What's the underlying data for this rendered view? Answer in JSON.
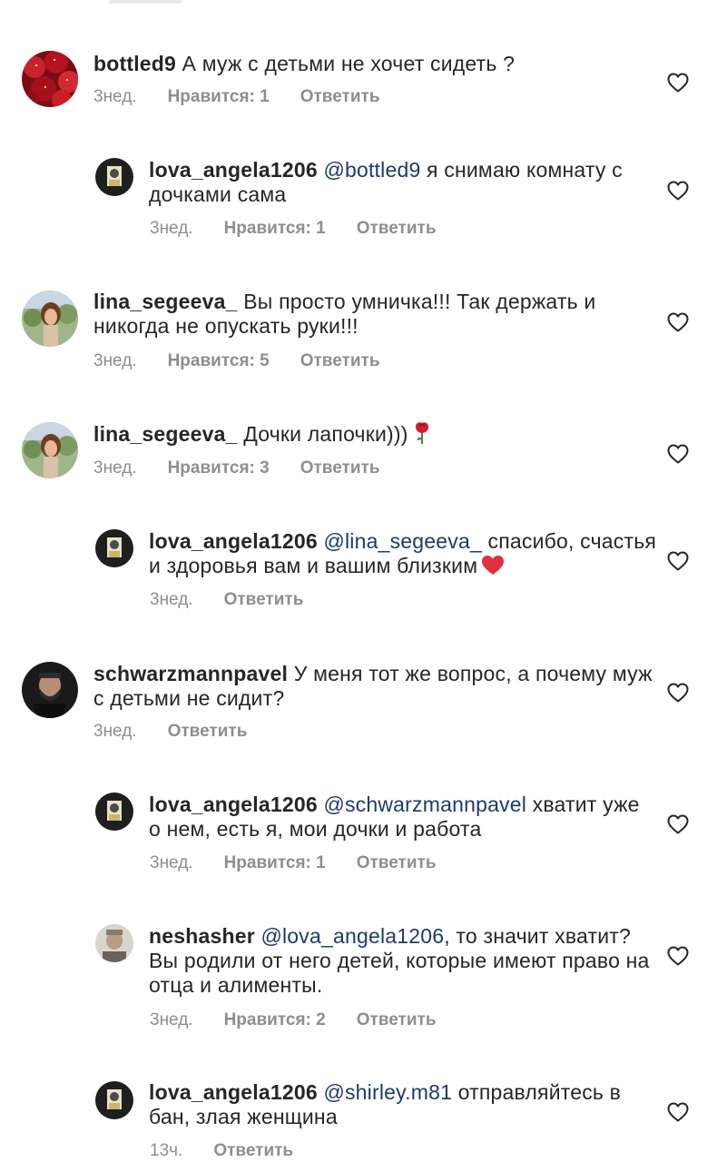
{
  "comments": [
    {
      "username": "bottled9",
      "mention": "",
      "text": "А муж с детьми не хочет сидеть ?",
      "time": "3нед.",
      "likes": "Нравится: 1",
      "reply_label": "Ответить",
      "avatar": "strawberries-avatar"
    },
    {
      "username": "lova_angela1206",
      "mention": "@bottled9",
      "text": "я снимаю комнату с дочками сама",
      "time": "3нед.",
      "likes": "Нравится: 1",
      "reply_label": "Ответить",
      "avatar": "dark-avatar"
    },
    {
      "username": "lina_segeeva_",
      "mention": "",
      "text": "Вы просто умничка!!! Так держать и никогда не опускать руки!!!",
      "time": "3нед.",
      "likes": "Нравится: 5",
      "reply_label": "Ответить",
      "avatar": "woman-avatar"
    },
    {
      "username": "lina_segeeva_",
      "mention": "",
      "text": "Дочки лапочки)))",
      "emoji": "rose-emoji",
      "time": "3нед.",
      "likes": "Нравится: 3",
      "reply_label": "Ответить",
      "avatar": "woman-avatar"
    },
    {
      "username": "lova_angela1206",
      "mention": "@lina_segeeva_",
      "text": "спасибо, счастья и здоровья вам и вашим близким",
      "emoji": "red-heart-emoji",
      "time": "3нед.",
      "likes": "",
      "reply_label": "Ответить",
      "avatar": "dark-avatar"
    },
    {
      "username": "schwarzmannpavel",
      "mention": "",
      "text": "У меня тот же вопрос, а почему муж с детьми не сидит?",
      "time": "3нед.",
      "likes": "",
      "reply_label": "Ответить",
      "avatar": "man-avatar"
    },
    {
      "username": "lova_angela1206",
      "mention": "@schwarzmannpavel",
      "text": "хватит уже о нем, есть я, мои дочки и работа",
      "time": "3нед.",
      "likes": "Нравится: 1",
      "reply_label": "Ответить",
      "avatar": "dark-avatar"
    },
    {
      "username": "neshasher",
      "mention": "@lova_angela1206",
      "text": ", то значит хватит? Вы родили от него детей, которые имеют право на отца и алименты.",
      "time": "3нед.",
      "likes": "Нравится: 2",
      "reply_label": "Ответить",
      "avatar": "light-avatar"
    },
    {
      "username": "lova_angela1206",
      "mention": "@shirley.m81",
      "text": "отправляйтесь в бан, злая женщина",
      "time": "13ч.",
      "likes": "",
      "reply_label": "Ответить",
      "avatar": "dark-avatar"
    }
  ],
  "colors": {
    "username": "#262626",
    "mention": "#1e3a6e",
    "meta": "#8e8e8e",
    "heart_outline": "#262626"
  },
  "icons": {
    "like": "heart-outline-icon"
  }
}
